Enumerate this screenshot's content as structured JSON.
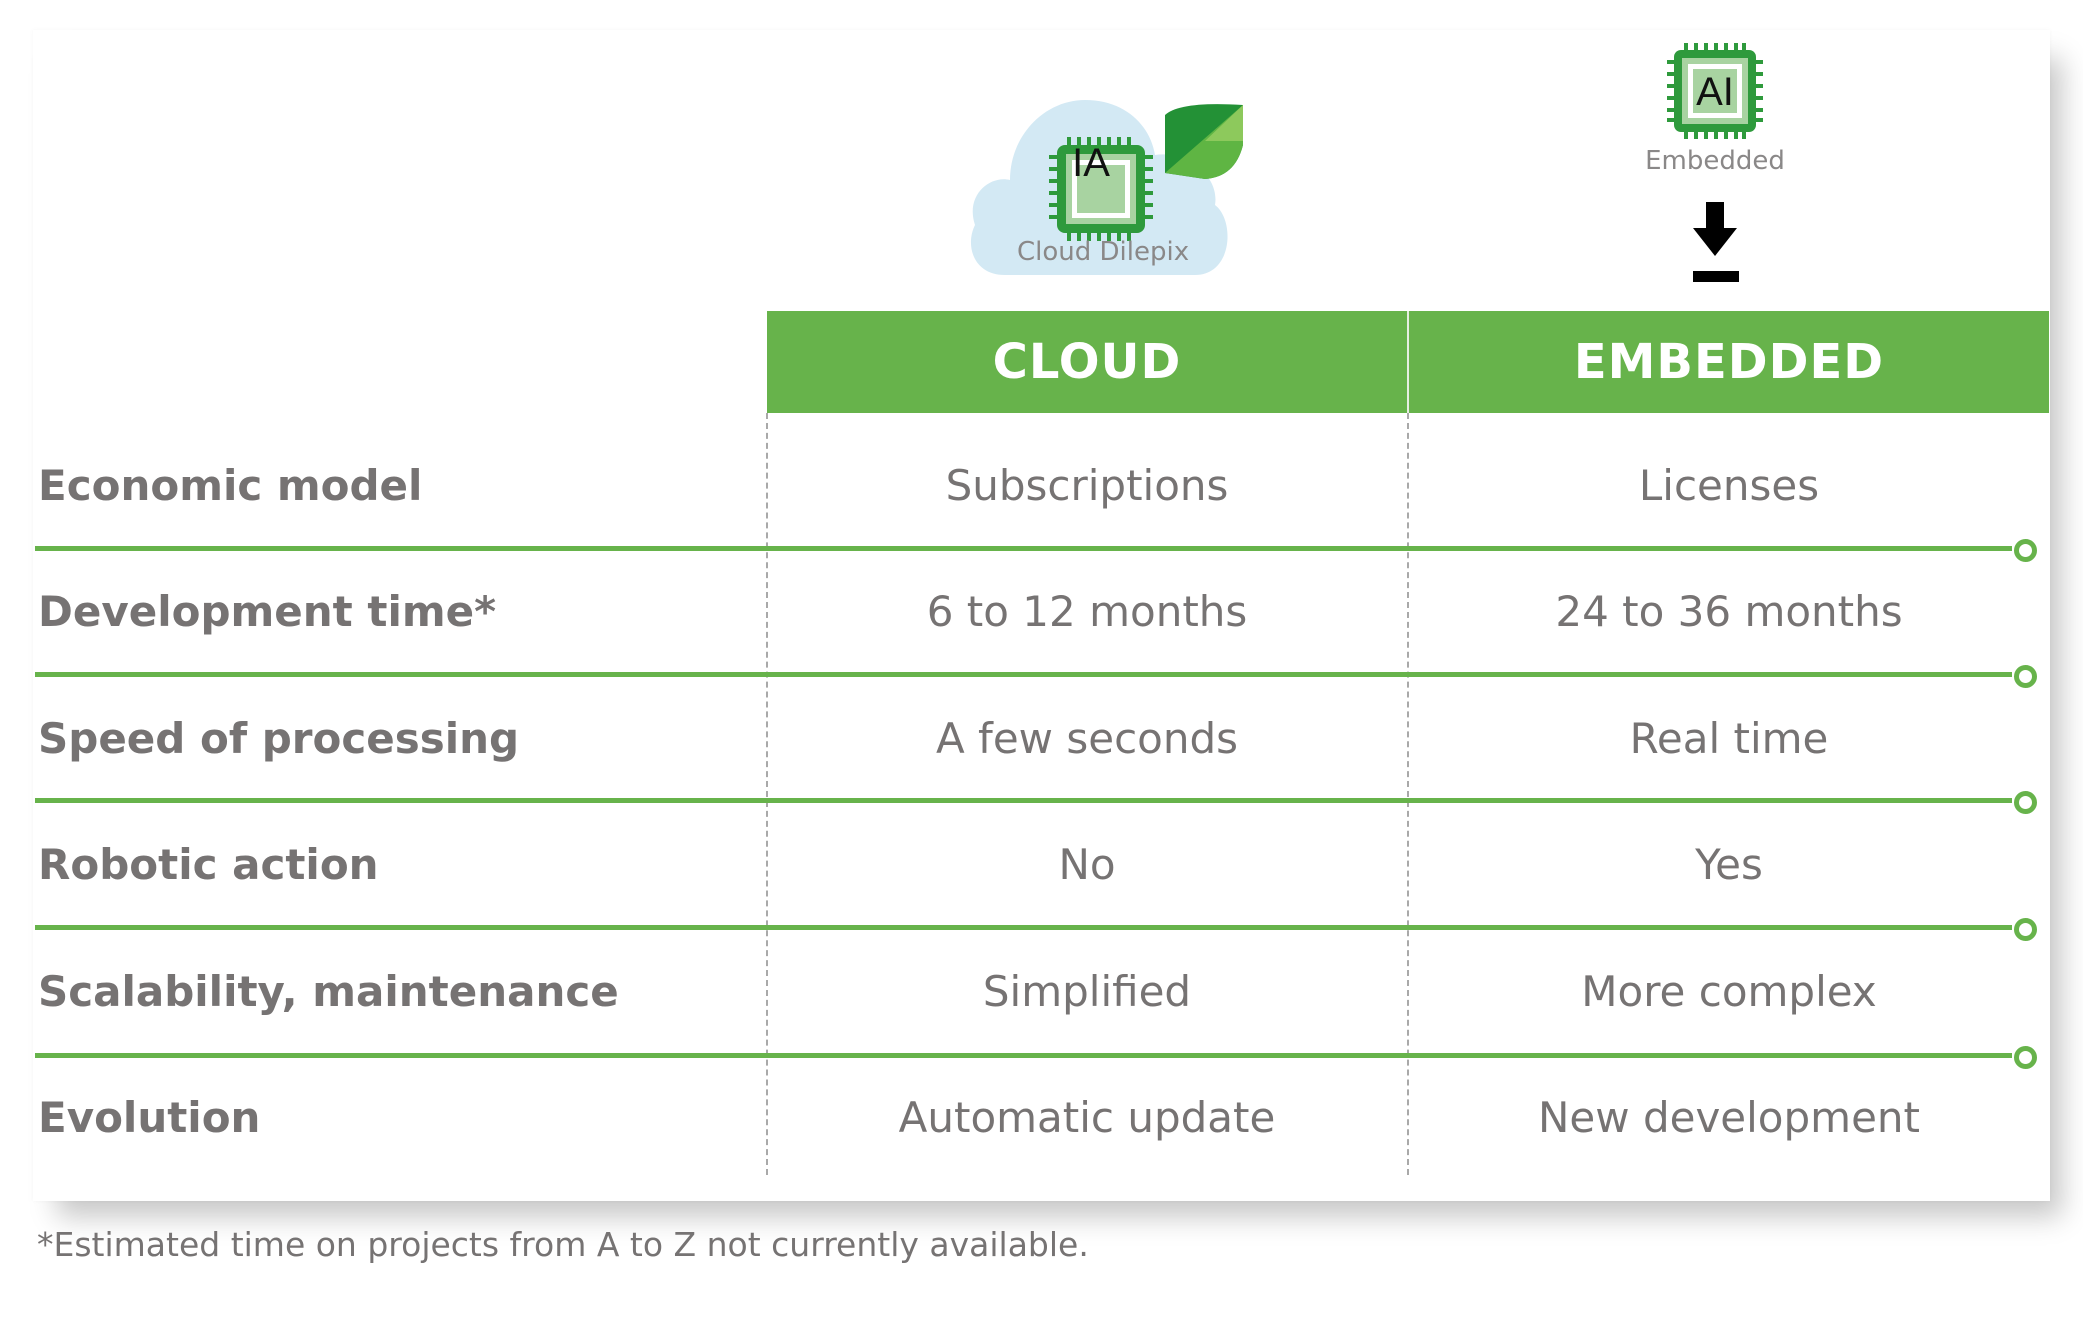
{
  "logos": {
    "cloud": {
      "chip_text": "IA",
      "caption": "Cloud Dilepix"
    },
    "embedded": {
      "chip_text": "AI",
      "caption": "Embedded"
    }
  },
  "columns": [
    "CLOUD",
    "EMBEDDED"
  ],
  "rows": [
    {
      "label": "Economic model",
      "cloud": "Subscriptions",
      "embedded": "Licenses"
    },
    {
      "label": "Development time*",
      "cloud": "6 to 12 months",
      "embedded": "24 to 36 months"
    },
    {
      "label": "Speed of processing",
      "cloud": "A few seconds",
      "embedded": "Real time"
    },
    {
      "label": "Robotic action",
      "cloud": "No",
      "embedded": "Yes"
    },
    {
      "label": "Scalability, maintenance",
      "cloud": "Simplified",
      "embedded": "More complex"
    },
    {
      "label": "Evolution",
      "cloud": "Automatic update",
      "embedded": "New development"
    }
  ],
  "footnote": "*Estimated time on projects from A to Z not currently available.",
  "colors": {
    "accent_green": "#67b34b",
    "chip_green": "#2e9a3c",
    "cloud_blue": "#d3e9f4",
    "text_gray": "#767373"
  }
}
